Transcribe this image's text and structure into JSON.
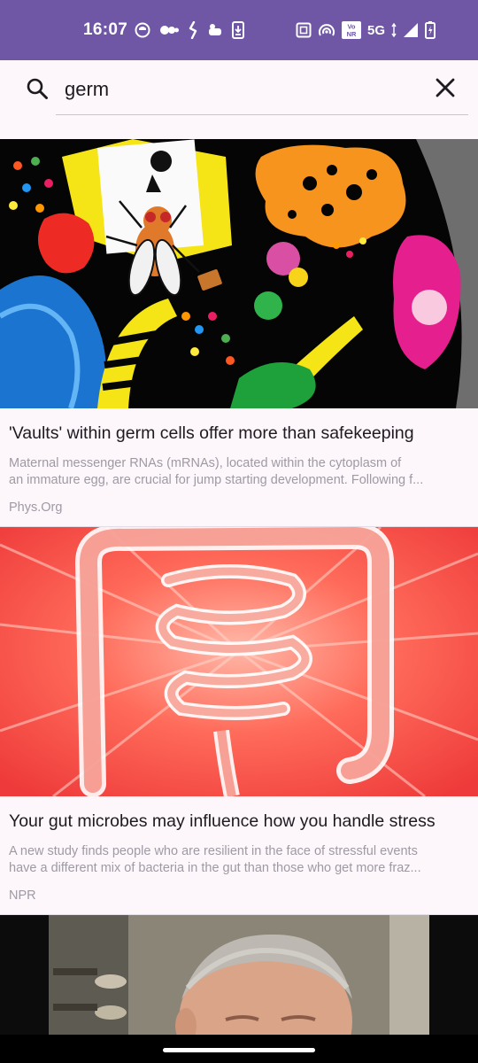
{
  "status_bar": {
    "time": "16:07",
    "network": "5G",
    "left_icons": [
      "emoji-notification-icon",
      "voicemail-icon",
      "phone-call-icon",
      "wallet-icon",
      "download-icon"
    ],
    "right_icons": [
      "nfc-icon",
      "hotspot-icon",
      "vonr-icon",
      "signal-icon",
      "battery-icon"
    ],
    "vonr_label": "Vo NR",
    "background_color": "#6f57a6"
  },
  "search": {
    "value": "germ",
    "placeholder": "Search"
  },
  "articles": [
    {
      "title": "'Vaults' within germ cells offer more than safekeeping",
      "description": [
        "Maternal messenger RNAs (mRNAs), located within the cytoplasm of",
        "an immature egg, are crucial for jump starting development. Following f..."
      ],
      "source": "Phys.Org",
      "image": "colorful-cell-illustration-with-fruit-fly"
    },
    {
      "title": "Your gut microbes may influence how you handle stress",
      "description": [
        "A new study finds people who are resilient in the face of stressful events",
        "have a different mix of bacteria in the gut than those who get more fraz..."
      ],
      "source": "NPR",
      "image": "white-intestine-illustration-on-red-background"
    },
    {
      "image": "photo-of-man-with-short-gray-hair"
    }
  ],
  "colors": {
    "background": "#fdf7fb",
    "text_primary": "#1d1b20",
    "text_secondary": "#9e9aa4"
  }
}
